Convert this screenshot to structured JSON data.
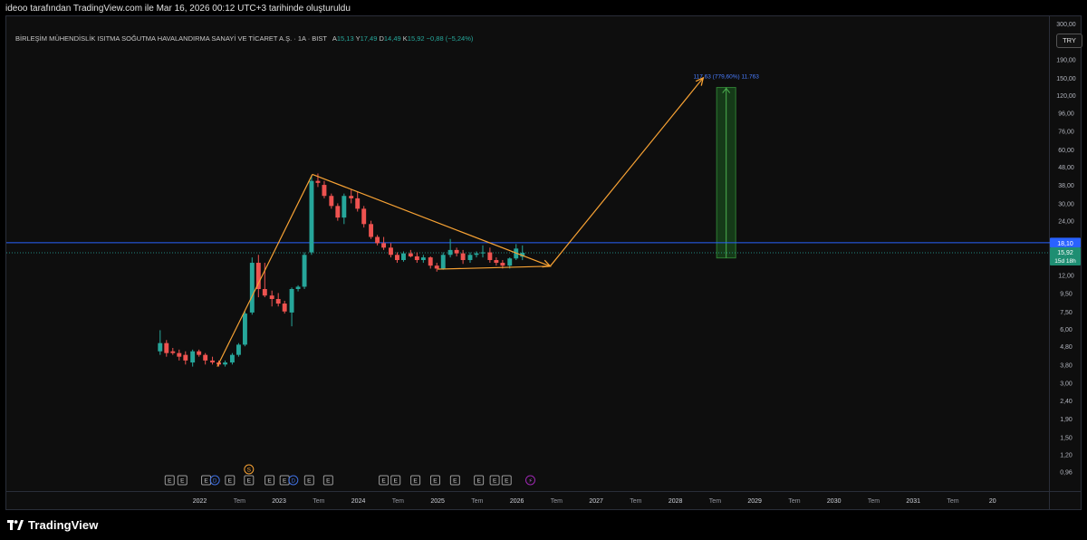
{
  "header": {
    "text": "ideoo tarafından TradingView.com ile Mar 16, 2026 00:12 UTC+3 tarihinde oluşturuldu"
  },
  "legend": {
    "symbol": "BİRLEŞİM MÜHENDİSLİK ISITMA SOĞUTMA HAVALANDIRMA SANAYİ VE TİCARET A.Ş. · 1A · BIST",
    "open_label": "A",
    "open": "15,13",
    "high_label": "Y",
    "high": "17,49",
    "low_label": "D",
    "low": "14,49",
    "close_label": "K",
    "close": "15,92",
    "change": "−0,88 (−5,24%)"
  },
  "currency_button": "TRY",
  "price_tags": {
    "line_price": "18,10",
    "last_price": "15,92",
    "countdown": "15d 18h"
  },
  "measure_label": "117,63 (779,60%) 11.763",
  "footer": {
    "brand": "TradingView"
  },
  "colors": {
    "up": "#26a69a",
    "down": "#ef5350",
    "arrow": "#f7a234",
    "hline": "#2962ff",
    "measure": "#1b5e20",
    "background": "#000000"
  },
  "event_markers": [
    {
      "date": 2021.62,
      "label": "E"
    },
    {
      "date": 2021.78,
      "label": "E"
    },
    {
      "date": 2022.08,
      "label": "E"
    },
    {
      "date": 2022.19,
      "label": "D",
      "kind": "dividend"
    },
    {
      "date": 2022.38,
      "label": "E"
    },
    {
      "date": 2022.62,
      "label": "E"
    },
    {
      "date": 2022.88,
      "label": "E"
    },
    {
      "date": 2023.07,
      "label": "E"
    },
    {
      "date": 2023.18,
      "label": "D",
      "kind": "dividend"
    },
    {
      "date": 2023.38,
      "label": "E"
    },
    {
      "date": 2023.62,
      "label": "E"
    },
    {
      "date": 2024.32,
      "label": "E"
    },
    {
      "date": 2024.47,
      "label": "E"
    },
    {
      "date": 2024.72,
      "label": "E"
    },
    {
      "date": 2024.97,
      "label": "E"
    },
    {
      "date": 2025.22,
      "label": "E"
    },
    {
      "date": 2025.52,
      "label": "E"
    },
    {
      "date": 2025.72,
      "label": "E"
    },
    {
      "date": 2025.87,
      "label": "E"
    },
    {
      "date": 2026.17,
      "label": "⚡",
      "kind": "news"
    },
    {
      "date": 2022.62,
      "label": "S",
      "kind": "split"
    }
  ],
  "chart_data": {
    "type": "candlestick",
    "scale": "log",
    "ylim": [
      0.75,
      330
    ],
    "xlim": [
      2019.56,
      2032.7
    ],
    "x_ticks": [
      {
        "date": 2022.0,
        "label": "2022"
      },
      {
        "date": 2022.5,
        "label": "Tem"
      },
      {
        "date": 2023.0,
        "label": "2023"
      },
      {
        "date": 2023.5,
        "label": "Tem"
      },
      {
        "date": 2024.0,
        "label": "2024"
      },
      {
        "date": 2024.5,
        "label": "Tem"
      },
      {
        "date": 2025.0,
        "label": "2025"
      },
      {
        "date": 2025.5,
        "label": "Tem"
      },
      {
        "date": 2026.0,
        "label": "2026"
      },
      {
        "date": 2026.5,
        "label": "Tem"
      },
      {
        "date": 2027.0,
        "label": "2027"
      },
      {
        "date": 2027.5,
        "label": "Tem"
      },
      {
        "date": 2028.0,
        "label": "2028"
      },
      {
        "date": 2028.5,
        "label": "Tem"
      },
      {
        "date": 2029.0,
        "label": "2029"
      },
      {
        "date": 2029.5,
        "label": "Tem"
      },
      {
        "date": 2030.0,
        "label": "2030"
      },
      {
        "date": 2030.5,
        "label": "Tem"
      },
      {
        "date": 2031.0,
        "label": "2031"
      },
      {
        "date": 2031.5,
        "label": "Tem"
      },
      {
        "date": 2032.0,
        "label": "20"
      }
    ],
    "y_ticks": [
      {
        "v": 300,
        "label": "300,00"
      },
      {
        "v": 240,
        "label": "240,00"
      },
      {
        "v": 190,
        "label": "190,00"
      },
      {
        "v": 150,
        "label": "150,00"
      },
      {
        "v": 120,
        "label": "120,00"
      },
      {
        "v": 96,
        "label": "96,00"
      },
      {
        "v": 76,
        "label": "76,00"
      },
      {
        "v": 60,
        "label": "60,00"
      },
      {
        "v": 48,
        "label": "48,00"
      },
      {
        "v": 38,
        "label": "38,00"
      },
      {
        "v": 30,
        "label": "30,00"
      },
      {
        "v": 24,
        "label": "24,00"
      },
      {
        "v": 12,
        "label": "12,00"
      },
      {
        "v": 9.5,
        "label": "9,50"
      },
      {
        "v": 7.5,
        "label": "7,50"
      },
      {
        "v": 6,
        "label": "6,00"
      },
      {
        "v": 4.8,
        "label": "4,80"
      },
      {
        "v": 3.8,
        "label": "3,80"
      },
      {
        "v": 3,
        "label": "3,00"
      },
      {
        "v": 2.4,
        "label": "2,40"
      },
      {
        "v": 1.9,
        "label": "1,90"
      },
      {
        "v": 1.5,
        "label": "1,50"
      },
      {
        "v": 1.2,
        "label": "1,20"
      },
      {
        "v": 0.96,
        "label": "0,96"
      },
      {
        "v": 0.77,
        "label": "0,77"
      }
    ],
    "candles": [
      {
        "t": 2021.5,
        "o": 4.5,
        "h": 5.9,
        "l": 4.3,
        "c": 5.0
      },
      {
        "t": 2021.58,
        "o": 5.0,
        "h": 5.2,
        "l": 4.2,
        "c": 4.4
      },
      {
        "t": 2021.66,
        "o": 4.5,
        "h": 4.7,
        "l": 4.3,
        "c": 4.4
      },
      {
        "t": 2021.74,
        "o": 4.4,
        "h": 4.6,
        "l": 4.0,
        "c": 4.2
      },
      {
        "t": 2021.82,
        "o": 4.3,
        "h": 4.5,
        "l": 3.8,
        "c": 4.0
      },
      {
        "t": 2021.91,
        "o": 3.9,
        "h": 4.6,
        "l": 3.7,
        "c": 4.5
      },
      {
        "t": 2021.99,
        "o": 4.5,
        "h": 4.6,
        "l": 4.2,
        "c": 4.3
      },
      {
        "t": 2022.07,
        "o": 4.3,
        "h": 4.4,
        "l": 3.8,
        "c": 4.0
      },
      {
        "t": 2022.16,
        "o": 4.0,
        "h": 4.2,
        "l": 3.8,
        "c": 3.9
      },
      {
        "t": 2022.24,
        "o": 3.9,
        "h": 4.0,
        "l": 3.7,
        "c": 3.8
      },
      {
        "t": 2022.32,
        "o": 3.8,
        "h": 4.0,
        "l": 3.7,
        "c": 3.9
      },
      {
        "t": 2022.41,
        "o": 3.9,
        "h": 4.4,
        "l": 3.8,
        "c": 4.3
      },
      {
        "t": 2022.49,
        "o": 4.3,
        "h": 5.0,
        "l": 4.2,
        "c": 4.9
      },
      {
        "t": 2022.57,
        "o": 4.9,
        "h": 7.5,
        "l": 4.8,
        "c": 7.3
      },
      {
        "t": 2022.66,
        "o": 7.4,
        "h": 15.0,
        "l": 7.2,
        "c": 14.0
      },
      {
        "t": 2022.74,
        "o": 14.0,
        "h": 15.5,
        "l": 9.0,
        "c": 10.0
      },
      {
        "t": 2022.82,
        "o": 10.0,
        "h": 14.0,
        "l": 9.0,
        "c": 9.2
      },
      {
        "t": 2022.91,
        "o": 9.2,
        "h": 9.8,
        "l": 8.0,
        "c": 8.8
      },
      {
        "t": 2022.99,
        "o": 8.8,
        "h": 9.5,
        "l": 8.0,
        "c": 8.3
      },
      {
        "t": 2023.07,
        "o": 8.3,
        "h": 8.6,
        "l": 7.3,
        "c": 7.5
      },
      {
        "t": 2023.16,
        "o": 7.4,
        "h": 10.2,
        "l": 6.2,
        "c": 10.0
      },
      {
        "t": 2023.24,
        "o": 10.0,
        "h": 10.5,
        "l": 9.7,
        "c": 10.3
      },
      {
        "t": 2023.32,
        "o": 10.3,
        "h": 16.0,
        "l": 10.0,
        "c": 15.5
      },
      {
        "t": 2023.41,
        "o": 16.0,
        "h": 43.0,
        "l": 15.5,
        "c": 40.0
      },
      {
        "t": 2023.49,
        "o": 40.0,
        "h": 44.0,
        "l": 37.0,
        "c": 39.0
      },
      {
        "t": 2023.57,
        "o": 38.0,
        "h": 40.0,
        "l": 32.0,
        "c": 33.0
      },
      {
        "t": 2023.66,
        "o": 33.0,
        "h": 34.0,
        "l": 28.0,
        "c": 29.0
      },
      {
        "t": 2023.74,
        "o": 29.0,
        "h": 30.0,
        "l": 24.0,
        "c": 25.0
      },
      {
        "t": 2023.82,
        "o": 25.0,
        "h": 34.0,
        "l": 23.0,
        "c": 33.0
      },
      {
        "t": 2023.91,
        "o": 33.0,
        "h": 36.0,
        "l": 30.0,
        "c": 32.0
      },
      {
        "t": 2023.99,
        "o": 32.0,
        "h": 35.0,
        "l": 27.0,
        "c": 28.0
      },
      {
        "t": 2024.07,
        "o": 28.0,
        "h": 29.0,
        "l": 22.0,
        "c": 23.0
      },
      {
        "t": 2024.16,
        "o": 23.0,
        "h": 24.0,
        "l": 19.0,
        "c": 19.5
      },
      {
        "t": 2024.24,
        "o": 19.5,
        "h": 20.0,
        "l": 17.5,
        "c": 18.0
      },
      {
        "t": 2024.32,
        "o": 18.0,
        "h": 19.5,
        "l": 16.5,
        "c": 17.0
      },
      {
        "t": 2024.41,
        "o": 17.0,
        "h": 18.0,
        "l": 15.0,
        "c": 15.5
      },
      {
        "t": 2024.49,
        "o": 15.5,
        "h": 16.0,
        "l": 14.0,
        "c": 14.5
      },
      {
        "t": 2024.57,
        "o": 14.5,
        "h": 16.2,
        "l": 14.2,
        "c": 15.8
      },
      {
        "t": 2024.66,
        "o": 15.8,
        "h": 16.5,
        "l": 15.0,
        "c": 15.2
      },
      {
        "t": 2024.74,
        "o": 15.2,
        "h": 16.0,
        "l": 14.0,
        "c": 14.5
      },
      {
        "t": 2024.82,
        "o": 14.5,
        "h": 15.5,
        "l": 14.0,
        "c": 15.0
      },
      {
        "t": 2024.91,
        "o": 15.0,
        "h": 15.2,
        "l": 13.0,
        "c": 13.5
      },
      {
        "t": 2024.99,
        "o": 13.5,
        "h": 14.0,
        "l": 12.5,
        "c": 13.0
      },
      {
        "t": 2025.07,
        "o": 13.0,
        "h": 16.0,
        "l": 12.8,
        "c": 15.5
      },
      {
        "t": 2025.16,
        "o": 15.5,
        "h": 19.0,
        "l": 15.0,
        "c": 16.5
      },
      {
        "t": 2025.24,
        "o": 16.5,
        "h": 17.0,
        "l": 15.2,
        "c": 15.8
      },
      {
        "t": 2025.32,
        "o": 15.8,
        "h": 16.5,
        "l": 13.8,
        "c": 14.5
      },
      {
        "t": 2025.41,
        "o": 14.5,
        "h": 16.0,
        "l": 14.0,
        "c": 15.5
      },
      {
        "t": 2025.49,
        "o": 15.5,
        "h": 16.2,
        "l": 15.0,
        "c": 15.8
      },
      {
        "t": 2025.57,
        "o": 15.8,
        "h": 17.5,
        "l": 15.0,
        "c": 16.0
      },
      {
        "t": 2025.66,
        "o": 16.0,
        "h": 17.0,
        "l": 14.0,
        "c": 14.5
      },
      {
        "t": 2025.74,
        "o": 14.5,
        "h": 15.0,
        "l": 13.5,
        "c": 14.0
      },
      {
        "t": 2025.82,
        "o": 14.0,
        "h": 14.5,
        "l": 13.0,
        "c": 13.5
      },
      {
        "t": 2025.91,
        "o": 13.5,
        "h": 15.0,
        "l": 13.0,
        "c": 14.8
      },
      {
        "t": 2025.99,
        "o": 14.8,
        "h": 17.8,
        "l": 14.5,
        "c": 16.8
      },
      {
        "t": 2026.07,
        "o": 15.13,
        "h": 17.49,
        "l": 14.49,
        "c": 15.92
      }
    ],
    "drawings": {
      "horizontal_line": 18.1,
      "last_price_line": 15.92,
      "upper_trendline": [
        {
          "t": 2023.42,
          "v": 43.5
        },
        {
          "t": 2026.42,
          "v": 13.4
        }
      ],
      "lower_trendline": [
        {
          "t": 2025.0,
          "v": 12.9
        },
        {
          "t": 2026.42,
          "v": 13.4
        }
      ],
      "impulse_arrow": [
        {
          "t": 2022.22,
          "v": 3.7
        },
        {
          "t": 2023.42,
          "v": 43.5
        }
      ],
      "projection_arrow": [
        {
          "t": 2026.42,
          "v": 13.4
        },
        {
          "t": 2028.35,
          "v": 150
        }
      ],
      "measure_box": {
        "t0": 2028.52,
        "t1": 2028.76,
        "v0": 14.9,
        "v1": 132.5
      }
    }
  }
}
